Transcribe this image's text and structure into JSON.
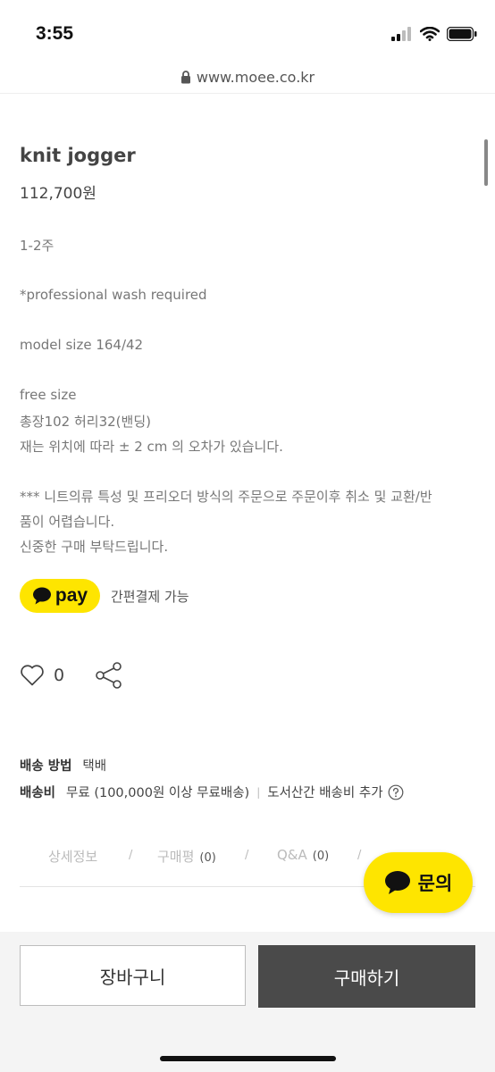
{
  "status": {
    "time": "3:55"
  },
  "browser": {
    "url": "www.moee.co.kr"
  },
  "product": {
    "title": "knit jogger",
    "price": "112,700원",
    "description": [
      "1-2주",
      "*professional wash required",
      "model size 164/42",
      "free size",
      "총장102 허리32(밴딩)",
      "재는 위치에 따라 ± 2 cm 의 오차가 있습니다.",
      "*** 니트의류 특성 및 프리오더 방식의 주문으로 주문이후 취소 및 교환/반",
      "품이 어렵습니다.",
      "신중한 구매 부탁드립니다."
    ]
  },
  "kakaopay": {
    "badge": "pay",
    "caption": "간편결제 가능"
  },
  "actions": {
    "like_count": "0"
  },
  "shipping": {
    "method_label": "배송 방법",
    "method_value": "택배",
    "fee_label": "배송비",
    "fee_value": "무료 (100,000원 이상 무료배송)",
    "extra": "도서산간 배송비 추가"
  },
  "tabs": [
    {
      "label": "상세정보",
      "count": ""
    },
    {
      "label": "구매평",
      "count": "(0)"
    },
    {
      "label": "Q&A",
      "count": "(0)"
    }
  ],
  "tab_separator": "/",
  "chat": {
    "label": "문의"
  },
  "bottom": {
    "cart_label": "장바구니",
    "buy_label": "구매하기"
  },
  "colors": {
    "kakao_yellow": "#FEE500",
    "buy_button": "#4a4a4a"
  }
}
